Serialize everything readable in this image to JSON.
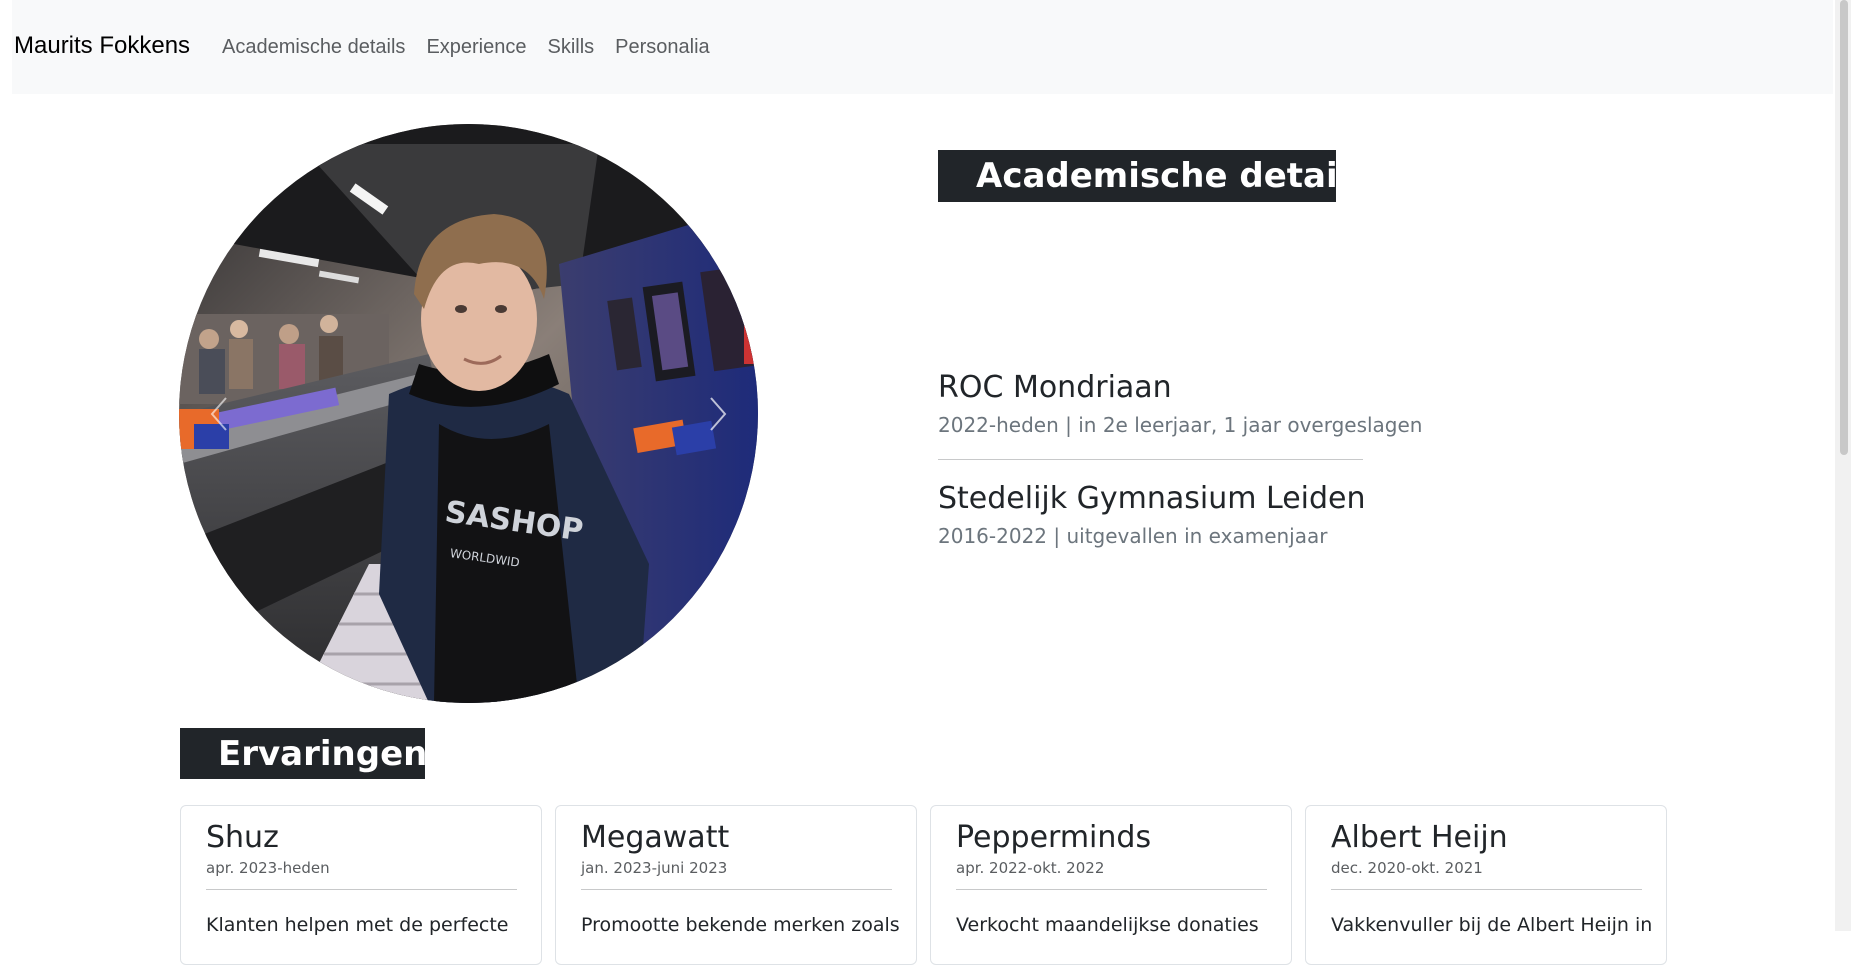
{
  "navbar": {
    "brand": "Maurits Fokkens",
    "links": [
      "Academische details",
      "Experience",
      "Skills",
      "Personalia"
    ]
  },
  "carousel": {
    "prev_icon": "chevron-left-icon",
    "next_icon": "chevron-right-icon"
  },
  "academic": {
    "heading": "Academische details",
    "items": [
      {
        "name": "ROC Mondriaan",
        "detail": "2022-heden | in 2e leerjaar, 1 jaar overgeslagen"
      },
      {
        "name": "Stedelijk Gymnasium Leiden",
        "detail": "2016-2022 | uitgevallen in examenjaar"
      }
    ]
  },
  "experience": {
    "heading": "Ervaringen",
    "cards": [
      {
        "title": "Shuz",
        "date": "apr. 2023-heden",
        "text": "Klanten helpen met de perfecte"
      },
      {
        "title": "Megawatt",
        "date": "jan. 2023-juni 2023",
        "text": "Promootte bekende merken zoals"
      },
      {
        "title": "Pepperminds",
        "date": "apr. 2022-okt. 2022",
        "text": "Verkocht maandelijkse donaties"
      },
      {
        "title": "Albert Heijn",
        "date": "dec. 2020-okt. 2021",
        "text": "Vakkenvuller bij de Albert Heijn in"
      }
    ]
  },
  "colors": {
    "navbar_bg": "#f8f9fa",
    "heading_bg": "#212529",
    "muted_text": "#6c757d"
  }
}
